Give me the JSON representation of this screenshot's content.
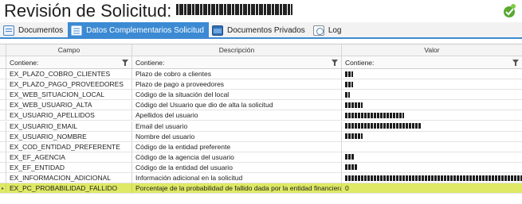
{
  "window": {
    "title": "Revisión de Solicitud:",
    "brand_color": "#3c8ad3"
  },
  "tabs": [
    {
      "label": "Documentos",
      "icon": "documents-icon",
      "active": false
    },
    {
      "label": "Datos Complementarios Solicitud",
      "icon": "data-sheet-icon",
      "active": true
    },
    {
      "label": "Documentos Privados",
      "icon": "private-folder-icon",
      "active": false
    },
    {
      "label": "Log",
      "icon": "log-icon",
      "active": false
    }
  ],
  "grid": {
    "columns": [
      "Campo",
      "Descripción",
      "Valor"
    ],
    "filter_label": "Contiene:",
    "rows": [
      {
        "campo": "EX_PLAZO_COBRO_CLIENTES",
        "descripcion": "Plazo de cobro a clientes",
        "valor": ""
      },
      {
        "campo": "EX_PLAZO_PAGO_PROVEEDORES",
        "descripcion": "Plazo de pago a proveedores",
        "valor": ""
      },
      {
        "campo": "EX_WEB_SITUACION_LOCAL",
        "descripcion": "Código de la situación del local",
        "valor": ""
      },
      {
        "campo": "EX_WEB_USUARIO_ALTA",
        "descripcion": "Código del Usuario que dio de alta la solicitud",
        "valor": ""
      },
      {
        "campo": "EX_USUARIO_APELLIDOS",
        "descripcion": "Apellidos del usuario",
        "valor": ""
      },
      {
        "campo": "EX_USUARIO_EMAIL",
        "descripcion": "Email del usuario",
        "valor": ""
      },
      {
        "campo": "EX_USUARIO_NOMBRE",
        "descripcion": "Nombre del usuario",
        "valor": ""
      },
      {
        "campo": "EX_COD_ENTIDAD_PREFERENTE",
        "descripcion": "Código de la entidad preferente",
        "valor": ""
      },
      {
        "campo": "EX_EF_AGENCIA",
        "descripcion": "Código de la agencia del usuario",
        "valor": ""
      },
      {
        "campo": "EX_EF_ENTIDAD",
        "descripcion": "Código de la entidad del usuario",
        "valor": ""
      },
      {
        "campo": "EX_INFORMACION_ADICIONAL",
        "descripcion": "Información adicional en la solicitud",
        "valor": ""
      },
      {
        "campo": "EX_PC_PROBABILIDAD_FALLIDO",
        "descripcion": "Porcentaje de la probabilidad de fallido dada por la entidad financiera",
        "valor": "0",
        "selected": true,
        "indicator": "▸"
      }
    ]
  }
}
